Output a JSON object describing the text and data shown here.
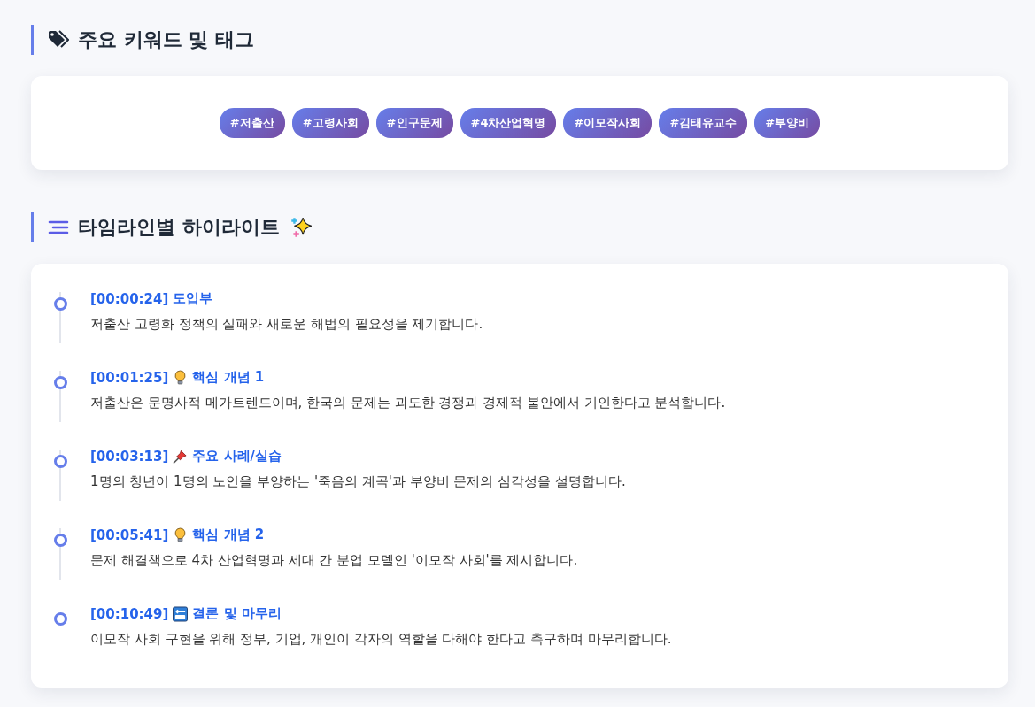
{
  "keywords_section": {
    "title": "주요 키워드 및 태그",
    "tags": [
      "#저출산",
      "#고령사회",
      "#인구문제",
      "#4차산업혁명",
      "#이모작사회",
      "#김태유교수",
      "#부양비"
    ]
  },
  "timeline_section": {
    "title": "타임라인별 하이라이트",
    "items": [
      {
        "time": "[00:00:24]",
        "kind": "intro",
        "title": "도입부",
        "description": "저출산 고령화 정책의 실패와 새로운 해법의 필요성을 제기합니다."
      },
      {
        "time": "[00:01:25]",
        "kind": "concept",
        "title": "핵심 개념 1",
        "description": "저출산은 문명사적 메가트렌드이며, 한국의 문제는 과도한 경쟁과 경제적 불안에서 기인한다고 분석합니다."
      },
      {
        "time": "[00:03:13]",
        "kind": "example",
        "title": "주요 사례/실습",
        "description": "1명의 청년이 1명의 노인을 부양하는 '죽음의 계곡'과 부양비 문제의 심각성을 설명합니다."
      },
      {
        "time": "[00:05:41]",
        "kind": "concept",
        "title": "핵심 개념 2",
        "description": "문제 해결책으로 4차 산업혁명과 세대 간 분업 모델인 '이모작 사회'를 제시합니다."
      },
      {
        "time": "[00:10:49]",
        "kind": "conclusion",
        "title": "결론 및 마무리",
        "description": "이모작 사회 구현을 위해 정부, 기업, 개인이 각자의 역할을 다해야 한다고 촉구하며 마무리합니다."
      }
    ]
  }
}
